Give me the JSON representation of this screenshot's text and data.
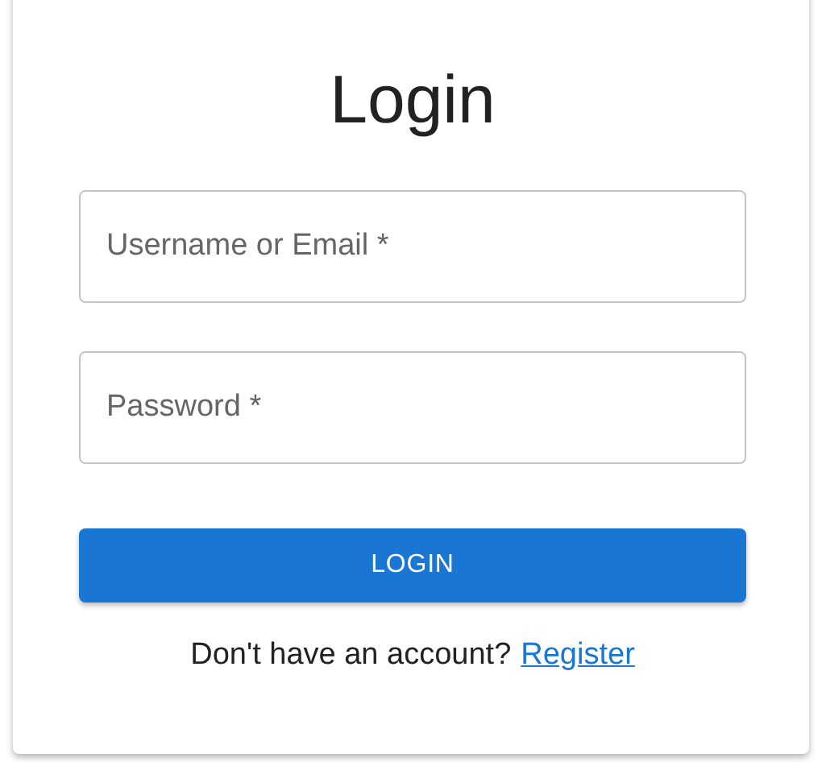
{
  "title": "Login",
  "fields": [
    {
      "placeholder": "Username or Email *"
    },
    {
      "placeholder": "Password *"
    }
  ],
  "button": "LOGIN",
  "footer": {
    "text": "Don't have an account?",
    "link": "Register"
  }
}
